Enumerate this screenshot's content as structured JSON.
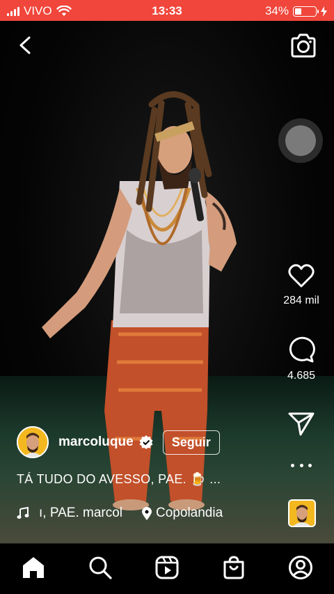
{
  "status": {
    "carrier": "VIVO",
    "time": "13:33",
    "battery": "34%",
    "battery_level": 0.34
  },
  "reel": {
    "likes": "284 mil",
    "comments": "4.685",
    "username": "marcoluque",
    "follow_label": "Seguir",
    "caption": "TÁ TUDO DO AVESSO, PAE. 🍺 ...",
    "music": "ı, PAE. marcol",
    "location": "Copolandia"
  },
  "icons": {
    "back": "chevron-left-icon",
    "camera": "camera-icon",
    "like": "heart-icon",
    "comment": "comment-icon",
    "share": "paper-plane-icon",
    "more": "more-dots-icon",
    "verified": "verified-badge-icon",
    "music": "music-note-icon",
    "location": "location-pin-icon",
    "nav": [
      "home-icon",
      "search-icon",
      "reels-icon",
      "shop-icon",
      "profile-icon"
    ]
  },
  "colors": {
    "status_bar": "#f0463b",
    "avatar_bg": "#f3b81f"
  }
}
